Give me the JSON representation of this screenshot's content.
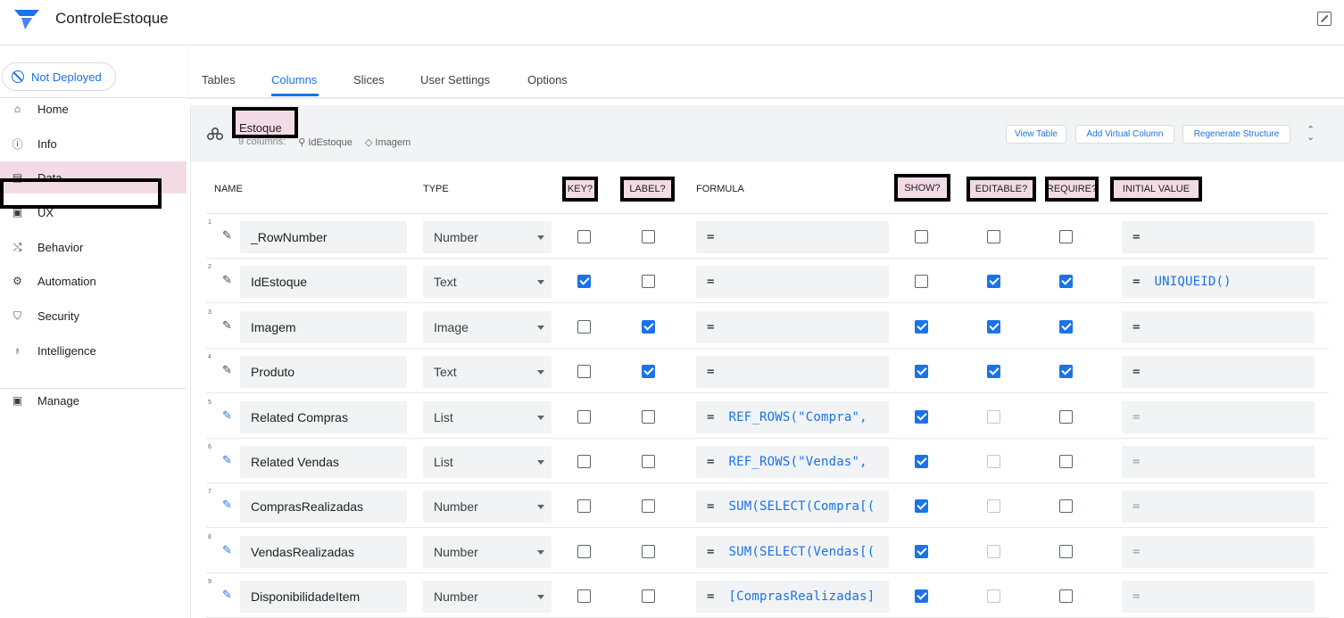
{
  "app": {
    "title": "ControleEstoque"
  },
  "deploy": {
    "label": "Not Deployed"
  },
  "nav": [
    {
      "label": "Home",
      "icon": "home-icon",
      "glyph": "⌂"
    },
    {
      "label": "Info",
      "icon": "info-icon",
      "glyph": "ⓘ"
    },
    {
      "label": "Data",
      "icon": "data-icon",
      "glyph": "▤"
    },
    {
      "label": "UX",
      "icon": "ux-icon",
      "glyph": "▣"
    },
    {
      "label": "Behavior",
      "icon": "behavior-icon",
      "glyph": "⤭"
    },
    {
      "label": "Automation",
      "icon": "automation-icon",
      "glyph": "⚙"
    },
    {
      "label": "Security",
      "icon": "shield-icon",
      "glyph": "⛉"
    },
    {
      "label": "Intelligence",
      "icon": "lightbulb-icon",
      "glyph": "♁"
    },
    {
      "label": "Manage",
      "icon": "manage-icon",
      "glyph": "▣"
    }
  ],
  "tabs": [
    "Tables",
    "Columns",
    "Slices",
    "User Settings",
    "Options"
  ],
  "table": {
    "name": "Estoque",
    "count": "9 columns:",
    "key": "IdEstoque",
    "label": "Imagem",
    "buttons": [
      "View Table",
      "Add Virtual Column",
      "Regenerate Structure"
    ]
  },
  "headers": {
    "name": "NAME",
    "type": "TYPE",
    "key": "KEY?",
    "label": "LABEL?",
    "formula": "FORMULA",
    "show": "SHOW?",
    "editable": "EDITABLE?",
    "require": "REQUIRE?",
    "initial": "INITIAL VALUE"
  },
  "rows": [
    {
      "n": "1",
      "name": "_RowNumber",
      "type": "Number",
      "key": false,
      "label": false,
      "formula": "",
      "show": false,
      "editable": false,
      "editable_disabled": false,
      "require": false,
      "initial": "",
      "initial_disabled": false,
      "virtual": false
    },
    {
      "n": "2",
      "name": "IdEstoque",
      "type": "Text",
      "key": true,
      "label": false,
      "formula": "",
      "show": false,
      "editable": true,
      "editable_disabled": false,
      "require": true,
      "initial": "UNIQUEID()",
      "initial_disabled": false,
      "virtual": false
    },
    {
      "n": "3",
      "name": "Imagem",
      "type": "Image",
      "key": false,
      "label": true,
      "formula": "",
      "show": true,
      "editable": true,
      "editable_disabled": false,
      "require": true,
      "initial": "",
      "initial_disabled": false,
      "virtual": false
    },
    {
      "n": "4",
      "name": "Produto",
      "type": "Text",
      "key": false,
      "label": true,
      "formula": "",
      "show": true,
      "editable": true,
      "editable_disabled": false,
      "require": true,
      "initial": "",
      "initial_disabled": false,
      "virtual": false
    },
    {
      "n": "5",
      "name": "Related Compras",
      "type": "List",
      "key": false,
      "label": false,
      "formula": "REF_ROWS(\"Compra\",",
      "show": true,
      "editable": false,
      "editable_disabled": true,
      "require": false,
      "initial": "",
      "initial_disabled": true,
      "virtual": true
    },
    {
      "n": "6",
      "name": "Related Vendas",
      "type": "List",
      "key": false,
      "label": false,
      "formula": "REF_ROWS(\"Vendas\",",
      "show": true,
      "editable": false,
      "editable_disabled": true,
      "require": false,
      "initial": "",
      "initial_disabled": true,
      "virtual": true
    },
    {
      "n": "7",
      "name": "ComprasRealizadas",
      "type": "Number",
      "key": false,
      "label": false,
      "formula": "SUM(SELECT(Compra[(",
      "show": true,
      "editable": false,
      "editable_disabled": true,
      "require": false,
      "initial": "",
      "initial_disabled": true,
      "virtual": true
    },
    {
      "n": "8",
      "name": "VendasRealizadas",
      "type": "Number",
      "key": false,
      "label": false,
      "formula": "SUM(SELECT(Vendas[(",
      "show": true,
      "editable": false,
      "editable_disabled": true,
      "require": false,
      "initial": "",
      "initial_disabled": true,
      "virtual": true
    },
    {
      "n": "9",
      "name": "DisponibilidadeItem",
      "type": "Number",
      "key": false,
      "label": false,
      "formula": "[ComprasRealizadas]",
      "show": true,
      "editable": false,
      "editable_disabled": true,
      "require": false,
      "initial": "",
      "initial_disabled": true,
      "virtual": true
    }
  ],
  "eq": "="
}
